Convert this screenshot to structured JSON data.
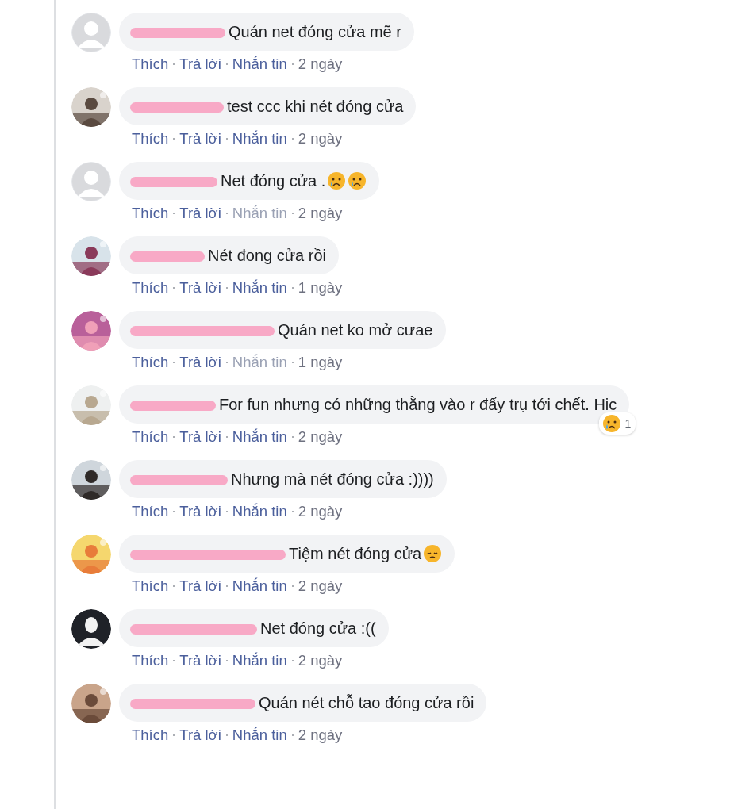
{
  "comments": [
    {
      "avatar": {
        "kind": "default"
      },
      "text": "Quán net đóng cửa mẽ r",
      "actions": [
        {
          "label": "Thích",
          "disabled": false
        },
        {
          "label": "Trả lời",
          "disabled": false
        },
        {
          "label": "Nhắn tin",
          "disabled": false
        }
      ],
      "time": "2 ngày"
    },
    {
      "avatar": {
        "kind": "picture"
      },
      "text": "test ccc khi nét đóng cửa",
      "actions": [
        {
          "label": "Thích",
          "disabled": false
        },
        {
          "label": "Trả lời",
          "disabled": false
        },
        {
          "label": "Nhắn tin",
          "disabled": false
        }
      ],
      "time": "2 ngày"
    },
    {
      "avatar": {
        "kind": "default"
      },
      "text": "Net đóng cửa .",
      "emojis": [
        {
          "kind": "crying"
        },
        {
          "kind": "crying"
        }
      ],
      "actions": [
        {
          "label": "Thích",
          "disabled": false
        },
        {
          "label": "Trả lời",
          "disabled": false
        },
        {
          "label": "Nhắn tin",
          "disabled": true
        }
      ],
      "time": "2 ngày"
    },
    {
      "avatar": {
        "kind": "picture"
      },
      "text": "Nét đong cửa rồi",
      "actions": [
        {
          "label": "Thích",
          "disabled": false
        },
        {
          "label": "Trả lời",
          "disabled": false
        },
        {
          "label": "Nhắn tin",
          "disabled": false
        }
      ],
      "time": "1 ngày"
    },
    {
      "avatar": {
        "kind": "picture"
      },
      "text": "Quán net ko mở cưae",
      "actions": [
        {
          "label": "Thích",
          "disabled": false
        },
        {
          "label": "Trả lời",
          "disabled": false
        },
        {
          "label": "Nhắn tin",
          "disabled": true
        }
      ],
      "time": "1 ngày"
    },
    {
      "avatar": {
        "kind": "picture"
      },
      "text": "For fun nhưng có những thằng vào r đẩy trụ tới chết. Hic",
      "reaction": {
        "kind": "crying",
        "count": "1"
      },
      "actions": [
        {
          "label": "Thích",
          "disabled": false
        },
        {
          "label": "Trả lời",
          "disabled": false
        },
        {
          "label": "Nhắn tin",
          "disabled": false
        }
      ],
      "time": "2 ngày"
    },
    {
      "avatar": {
        "kind": "picture"
      },
      "text": "Nhưng mà nét đóng cửa :))))",
      "actions": [
        {
          "label": "Thích",
          "disabled": false
        },
        {
          "label": "Trả lời",
          "disabled": false
        },
        {
          "label": "Nhắn tin",
          "disabled": false
        }
      ],
      "time": "2 ngày"
    },
    {
      "avatar": {
        "kind": "picture"
      },
      "text": "Tiệm nét đóng cửa",
      "emojis": [
        {
          "kind": "pensive"
        }
      ],
      "actions": [
        {
          "label": "Thích",
          "disabled": false
        },
        {
          "label": "Trả lời",
          "disabled": false
        },
        {
          "label": "Nhắn tin",
          "disabled": false
        }
      ],
      "time": "2 ngày"
    },
    {
      "avatar": {
        "kind": "silhouette"
      },
      "text": "Net đóng cửa :((",
      "actions": [
        {
          "label": "Thích",
          "disabled": false
        },
        {
          "label": "Trả lời",
          "disabled": false
        },
        {
          "label": "Nhắn tin",
          "disabled": false
        }
      ],
      "time": "2 ngày"
    },
    {
      "avatar": {
        "kind": "picture"
      },
      "text": "Quán nét chỗ tao đóng cửa rồi",
      "actions": [
        {
          "label": "Thích",
          "disabled": false
        },
        {
          "label": "Trả lời",
          "disabled": false
        },
        {
          "label": "Nhắn tin",
          "disabled": false
        }
      ],
      "time": "2 ngày"
    }
  ]
}
